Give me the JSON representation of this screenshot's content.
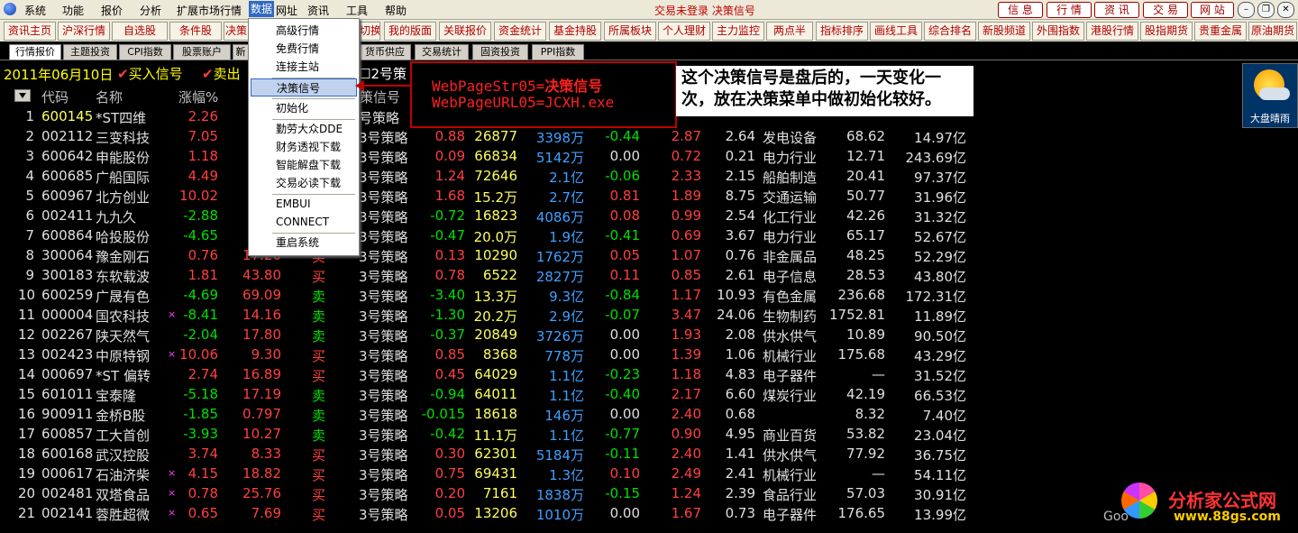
{
  "menubar": {
    "items": [
      "系统",
      "功能",
      "报价",
      "分析",
      "扩展市场行情",
      "数据",
      "网址",
      "资讯",
      "工具",
      "帮助"
    ],
    "status": "交易未登录 决策信号",
    "right_buttons": [
      "信 息",
      "行 情",
      "资 讯",
      "交 易",
      "网 站"
    ]
  },
  "toolbar": {
    "buttons": [
      "资讯主页",
      "沪深行情",
      "自选股",
      "条件股",
      "决策",
      "切换",
      "我的版面",
      "关联报价",
      "资金统计",
      "基金持股",
      "所属板块",
      "个人理财",
      "主力监控",
      "两点半",
      "指标排序",
      "画线工具",
      "综合排名",
      "新股频道",
      "外围指数",
      "港股行情",
      "股指期货",
      "贵重金属",
      "原油期货"
    ]
  },
  "tabs": [
    "行情报价",
    "主题投资",
    "CPI指数",
    "股票账户",
    "新",
    "货币供应",
    "交易统计",
    "固资投资",
    "PPI指数"
  ],
  "daterow": {
    "date": "2011年06月10日",
    "buy": "买入信号",
    "sell": "卖出",
    "strategy_check": "2号策"
  },
  "table": {
    "headers": {
      "code": "代码",
      "name": "名称",
      "pct": "涨幅%",
      "signal": "策信号"
    },
    "rows": [
      {
        "n": "1",
        "code": "600145",
        "name": "*ST四维",
        "pct": "2.26",
        "price": "",
        "act": "",
        "strat": "号策略",
        "v1": "",
        "v2": "",
        "v3": "",
        "v4": "",
        "v5": "",
        "v6": "",
        "ind": "",
        "v7": "",
        "v8": ""
      },
      {
        "n": "2",
        "code": "002112",
        "name": "三变科技",
        "pct": "7.05",
        "price": "",
        "act": "",
        "strat": "3号策略",
        "v1": "0.88",
        "v2": "26877",
        "v3": "3398万",
        "v4": "-0.44",
        "v5": "2.87",
        "v6": "2.64",
        "ind": "发电设备",
        "v7": "68.62",
        "v8": "14.97亿"
      },
      {
        "n": "3",
        "code": "600642",
        "name": "申能股份",
        "pct": "1.18",
        "price": "",
        "act": "",
        "strat": "3号策略",
        "v1": "0.09",
        "v2": "66834",
        "v3": "5142万",
        "v4": "0.00",
        "v5": "0.72",
        "v6": "0.21",
        "ind": "电力行业",
        "v7": "12.71",
        "v8": "243.69亿"
      },
      {
        "n": "4",
        "code": "600685",
        "name": "广船国际",
        "pct": "4.49",
        "price": "",
        "act": "",
        "strat": "3号策略",
        "v1": "1.24",
        "v2": "72646",
        "v3": "2.1亿",
        "v4": "-0.06",
        "v5": "2.33",
        "v6": "2.15",
        "ind": "船舶制造",
        "v7": "20.41",
        "v8": "97.37亿"
      },
      {
        "n": "5",
        "code": "600967",
        "name": "北方创业",
        "pct": "10.02",
        "price": "",
        "act": "",
        "strat": "3号策略",
        "v1": "1.68",
        "v2": "15.2万",
        "v3": "2.7亿",
        "v4": "0.81",
        "v5": "1.89",
        "v6": "8.75",
        "ind": "交通运输",
        "v7": "50.77",
        "v8": "31.96亿"
      },
      {
        "n": "6",
        "code": "002411",
        "name": "九九久",
        "pct": "-2.88",
        "price": "",
        "act": "",
        "strat": "3号策略",
        "v1": "-0.72",
        "v2": "16823",
        "v3": "4086万",
        "v4": "0.08",
        "v5": "0.99",
        "v6": "2.54",
        "ind": "化工行业",
        "v7": "42.26",
        "v8": "31.32亿"
      },
      {
        "n": "7",
        "code": "600864",
        "name": "哈投股份",
        "pct": "-4.65",
        "price": "",
        "act": "",
        "strat": "3号策略",
        "v1": "-0.47",
        "v2": "20.0万",
        "v3": "1.9亿",
        "v4": "-0.41",
        "v5": "0.69",
        "v6": "3.67",
        "ind": "电力行业",
        "v7": "65.17",
        "v8": "52.67亿"
      },
      {
        "n": "8",
        "code": "300064",
        "name": "豫金刚石",
        "pct": "0.76",
        "price": "17.20",
        "act": "买",
        "strat": "3号策略",
        "v1": "0.13",
        "v2": "10290",
        "v3": "1762万",
        "v4": "0.05",
        "v5": "1.07",
        "v6": "0.76",
        "ind": "非金属品",
        "v7": "48.25",
        "v8": "52.29亿"
      },
      {
        "n": "9",
        "code": "300183",
        "name": "东软载波",
        "pct": "1.81",
        "price": "43.80",
        "act": "买",
        "strat": "3号策略",
        "v1": "0.78",
        "v2": "6522",
        "v3": "2827万",
        "v4": "0.11",
        "v5": "0.85",
        "v6": "2.61",
        "ind": "电子信息",
        "v7": "28.53",
        "v8": "43.80亿"
      },
      {
        "n": "10",
        "code": "600259",
        "name": "广晟有色",
        "pct": "-4.69",
        "price": "69.09",
        "act": "卖",
        "strat": "3号策略",
        "v1": "-3.40",
        "v2": "13.3万",
        "v3": "9.3亿",
        "v4": "-0.84",
        "v5": "1.17",
        "v6": "10.93",
        "ind": "有色金属",
        "v7": "236.68",
        "v8": "172.31亿"
      },
      {
        "n": "11",
        "code": "000004",
        "name": "国农科技",
        "pct": "-8.41",
        "price": "14.16",
        "act": "卖",
        "strat": "3号策略",
        "v1": "-1.30",
        "v2": "20.2万",
        "v3": "2.9亿",
        "v4": "-0.07",
        "v5": "3.47",
        "v6": "24.06",
        "ind": "生物制药",
        "v7": "1752.81",
        "v8": "11.89亿"
      },
      {
        "n": "12",
        "code": "002267",
        "name": "陕天然气",
        "pct": "-2.04",
        "price": "17.80",
        "act": "卖",
        "strat": "3号策略",
        "v1": "-0.37",
        "v2": "20849",
        "v3": "3726万",
        "v4": "0.00",
        "v5": "1.93",
        "v6": "2.08",
        "ind": "供水供气",
        "v7": "10.89",
        "v8": "90.50亿"
      },
      {
        "n": "13",
        "code": "002423",
        "name": "中原特钢",
        "pct": "10.06",
        "price": "9.30",
        "act": "买",
        "strat": "3号策略",
        "v1": "0.85",
        "v2": "8368",
        "v3": "778万",
        "v4": "0.00",
        "v5": "1.39",
        "v6": "1.06",
        "ind": "机械行业",
        "v7": "175.68",
        "v8": "43.29亿"
      },
      {
        "n": "14",
        "code": "000697",
        "name": "*ST 偏转",
        "pct": "2.74",
        "price": "16.89",
        "act": "买",
        "strat": "3号策略",
        "v1": "0.45",
        "v2": "64029",
        "v3": "1.1亿",
        "v4": "-0.23",
        "v5": "1.18",
        "v6": "4.83",
        "ind": "电子器件",
        "v7": "—",
        "v8": "31.52亿"
      },
      {
        "n": "15",
        "code": "601011",
        "name": "宝泰隆",
        "pct": "-5.18",
        "price": "17.19",
        "act": "卖",
        "strat": "3号策略",
        "v1": "-0.94",
        "v2": "64011",
        "v3": "1.1亿",
        "v4": "-0.40",
        "v5": "2.17",
        "v6": "6.60",
        "ind": "煤炭行业",
        "v7": "42.19",
        "v8": "66.53亿"
      },
      {
        "n": "16",
        "code": "900911",
        "name": "金桥B股",
        "pct": "-1.85",
        "price": "0.797",
        "act": "卖",
        "strat": "3号策略",
        "v1": "-0.015",
        "v2": "18618",
        "v3": "146万",
        "v4": "0.00",
        "v5": "2.40",
        "v6": "0.68",
        "ind": "",
        "v7": "8.32",
        "v8": "7.40亿"
      },
      {
        "n": "17",
        "code": "600857",
        "name": "工大首创",
        "pct": "-3.93",
        "price": "10.27",
        "act": "卖",
        "strat": "3号策略",
        "v1": "-0.42",
        "v2": "11.1万",
        "v3": "1.1亿",
        "v4": "-0.77",
        "v5": "0.90",
        "v6": "4.95",
        "ind": "商业百货",
        "v7": "53.82",
        "v8": "23.04亿"
      },
      {
        "n": "18",
        "code": "600168",
        "name": "武汉控股",
        "pct": "3.74",
        "price": "8.33",
        "act": "买",
        "strat": "3号策略",
        "v1": "0.30",
        "v2": "62301",
        "v3": "5184万",
        "v4": "-0.11",
        "v5": "2.40",
        "v6": "1.41",
        "ind": "供水供气",
        "v7": "77.92",
        "v8": "36.75亿"
      },
      {
        "n": "19",
        "code": "000617",
        "name": "石油济柴",
        "pct": "4.15",
        "price": "18.82",
        "act": "买",
        "strat": "3号策略",
        "v1": "0.75",
        "v2": "69431",
        "v3": "1.3亿",
        "v4": "0.10",
        "v5": "2.49",
        "v6": "2.41",
        "ind": "机械行业",
        "v7": "—",
        "v8": "54.11亿"
      },
      {
        "n": "20",
        "code": "002481",
        "name": "双塔食品",
        "pct": "0.78",
        "price": "25.76",
        "act": "买",
        "strat": "3号策略",
        "v1": "0.20",
        "v2": "7161",
        "v3": "1838万",
        "v4": "-0.15",
        "v5": "1.24",
        "v6": "2.39",
        "ind": "食品行业",
        "v7": "57.03",
        "v8": "30.91亿"
      },
      {
        "n": "21",
        "code": "002141",
        "name": "蓉胜超微",
        "pct": "0.65",
        "price": "7.69",
        "act": "买",
        "strat": "3号策略",
        "v1": "0.05",
        "v2": "13206",
        "v3": "1010万",
        "v4": "0.00",
        "v5": "1.67",
        "v6": "0.73",
        "ind": "电子器件",
        "v7": "176.65",
        "v8": "13.99亿"
      }
    ]
  },
  "dropdown": {
    "items": [
      "高级行情",
      "免费行情",
      "连接主站",
      "决策信号",
      "初始化",
      "勤劳大众DDE",
      "财务透视下载",
      "智能解盘下载",
      "交易必读下载",
      "EMBUI",
      "CONNECT",
      "重启系统"
    ],
    "highlighted": "决策信号"
  },
  "annotation": {
    "line1_key": "WebPageStr05=",
    "line1_val": "决策信号",
    "line2": "WebPageURL05=JCXH.exe",
    "note": "这个决策信号是盘后的，一天变化一次，放在决策菜单中做初始化较好。"
  },
  "weather": {
    "label": "大盘晴雨"
  },
  "watermark": {
    "title": "分析家公式网",
    "url": "www.88gs.com",
    "prefix": "Goo"
  }
}
